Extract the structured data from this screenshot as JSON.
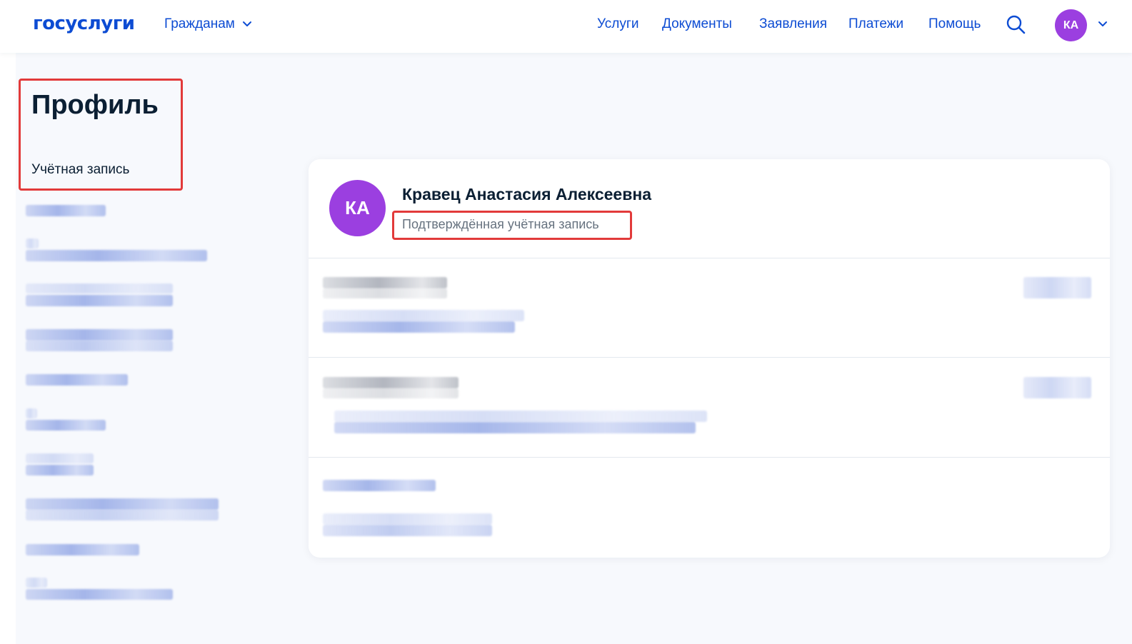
{
  "header": {
    "logo_part1": "гос",
    "logo_part2": "услуги",
    "audience_label": "Гражданам",
    "nav": [
      {
        "label": "Услуги"
      },
      {
        "label": "Документы"
      },
      {
        "label": "Заявления"
      },
      {
        "label": "Платежи"
      },
      {
        "label": "Помощь"
      }
    ],
    "avatar_initials": "КА",
    "icons": [
      "chevron-down-icon",
      "search-icon"
    ]
  },
  "sidebar": {
    "title": "Профиль",
    "active_item": "Учётная запись",
    "redacted_items_count_note": ""
  },
  "profile_card": {
    "avatar_initials": "КА",
    "full_name": "Кравец Анастасия Алексеевна",
    "status": "Подтверждённая учётная запись"
  },
  "colors": {
    "brand_blue": "#0d4cd3",
    "brand_red": "#ee3f58",
    "avatar_purple": "#9b3fe0",
    "highlight_red": "#e23a3a",
    "page_background": "#f7f9fd"
  }
}
